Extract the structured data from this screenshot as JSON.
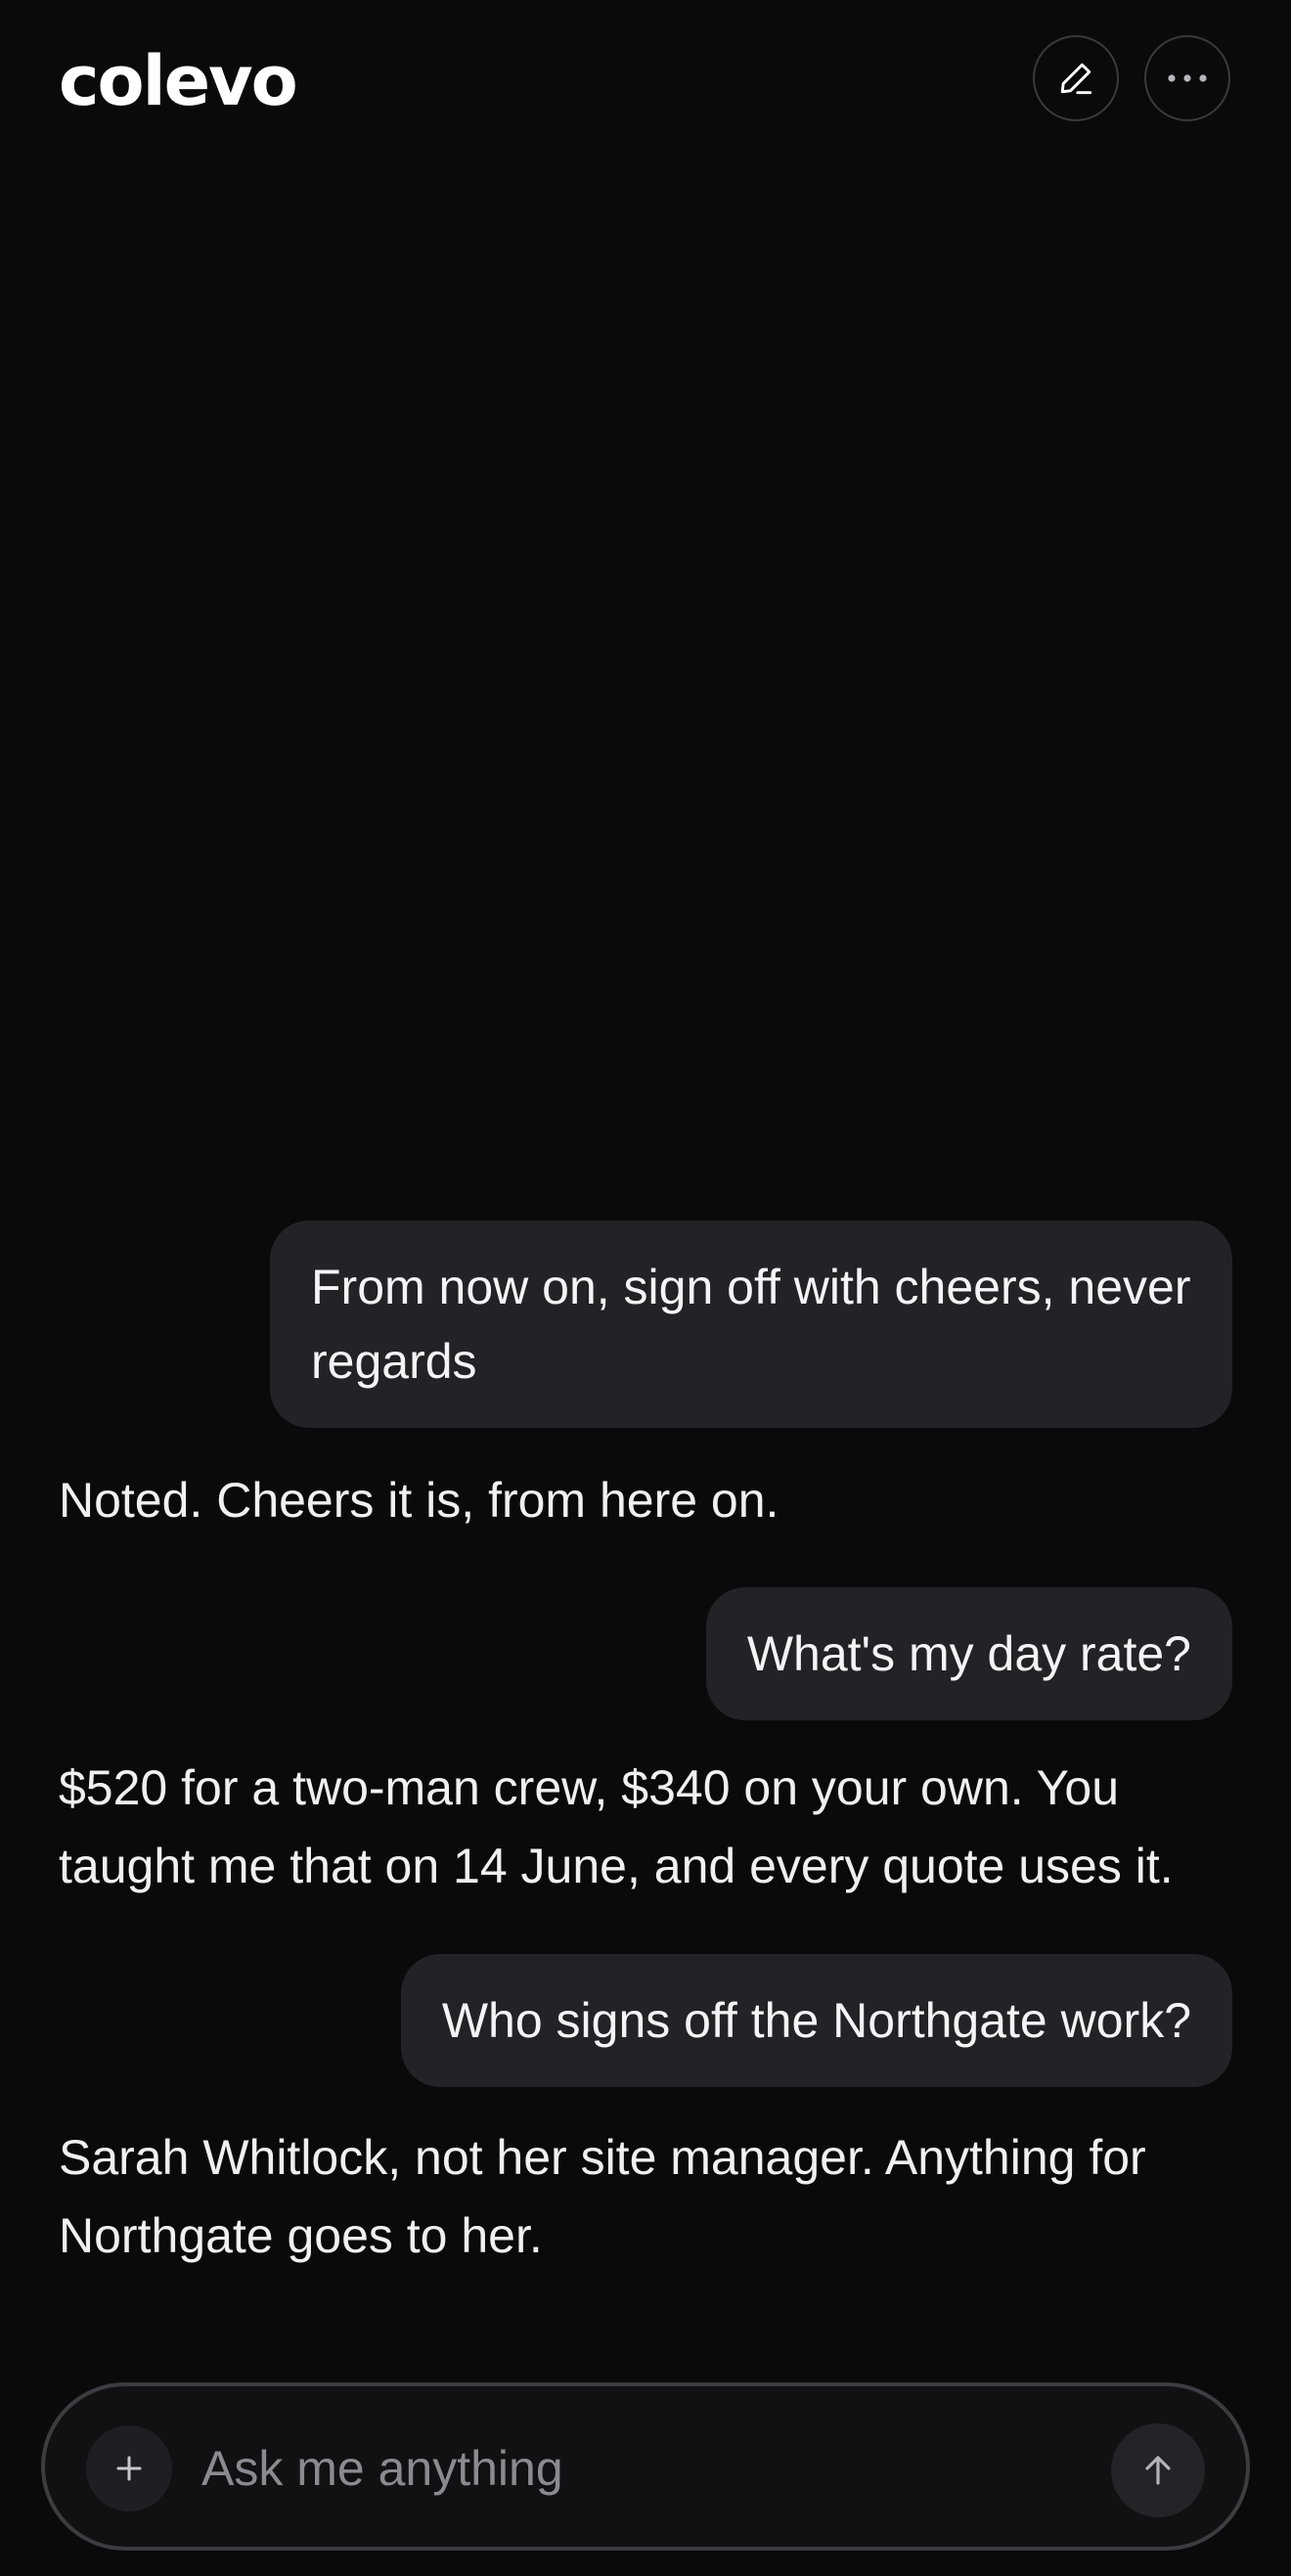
{
  "app": {
    "logo": "colevo"
  },
  "header": {
    "edit_icon": "pencil-icon",
    "more_icon": "ellipsis-icon"
  },
  "messages": [
    {
      "role": "user",
      "text": "From now on, sign off with cheers, never regards"
    },
    {
      "role": "assistant",
      "text": "Noted. Cheers it is, from here on."
    },
    {
      "role": "user",
      "text": "What's my day rate?"
    },
    {
      "role": "assistant",
      "text": "$520 for a two-man crew, $340 on your own. You taught me that on 14 June, and every quote uses it."
    },
    {
      "role": "user",
      "text": "Who signs off the Northgate work?"
    },
    {
      "role": "assistant",
      "text": "Sarah Whitlock, not her site manager. Anything for Northgate goes to her."
    }
  ],
  "composer": {
    "placeholder": "Ask me anything",
    "value": "",
    "attach_icon": "plus-icon",
    "send_icon": "arrow-up-icon"
  },
  "colors": {
    "background": "#0a0a0b",
    "user_bubble": "#222227",
    "text": "#f2f2f4",
    "placeholder": "#8a8a90"
  }
}
